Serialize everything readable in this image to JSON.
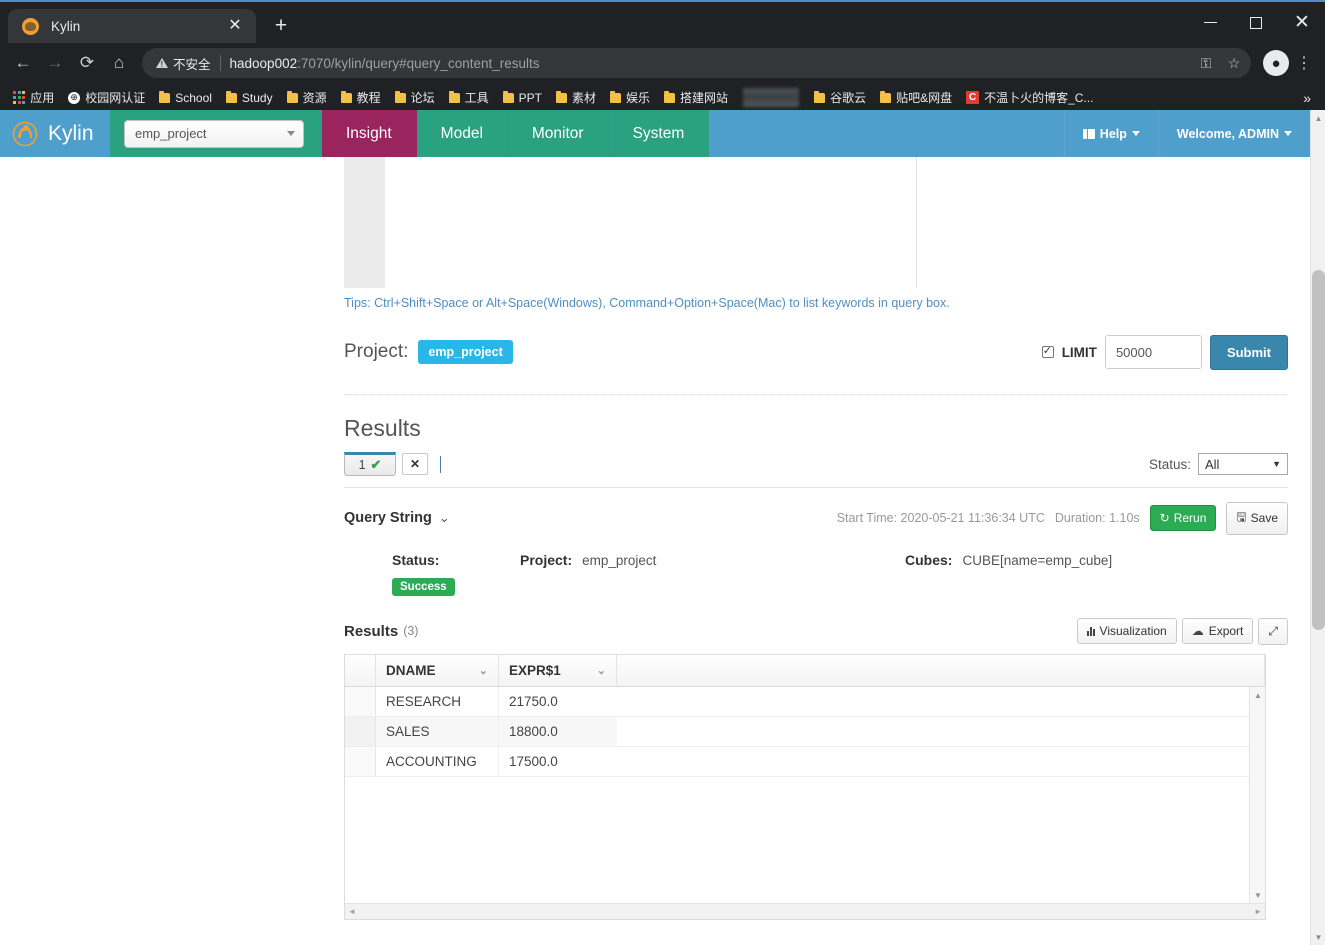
{
  "browser": {
    "tab": {
      "title": "Kylin",
      "favicon": "kylin-favicon",
      "close_label": "✕"
    },
    "new_tab_label": "+",
    "window": {
      "minimize": "—",
      "maximize": "□",
      "close": "✕"
    },
    "nav": {
      "back": "←",
      "forward": "→",
      "reload": "⟳",
      "home": "⌂"
    },
    "omnibox": {
      "security_text": "不安全",
      "url_host": "hadoop002",
      "url_rest": ":7070/kylin/query#query_content_results",
      "key_icon": "key-icon",
      "star_icon": "star-icon",
      "profile_icon": "profile-icon",
      "menu_icon": "kebab-menu-icon"
    },
    "bookmarks": [
      {
        "label": "应用",
        "icon": "apps-grid-icon"
      },
      {
        "label": "校园网认证",
        "icon": "globe-icon"
      },
      {
        "label": "School",
        "icon": "folder-icon"
      },
      {
        "label": "Study",
        "icon": "folder-icon"
      },
      {
        "label": "资源",
        "icon": "folder-icon"
      },
      {
        "label": "教程",
        "icon": "folder-icon"
      },
      {
        "label": "论坛",
        "icon": "folder-icon"
      },
      {
        "label": "工具",
        "icon": "folder-icon"
      },
      {
        "label": "PPT",
        "icon": "folder-icon"
      },
      {
        "label": "素材",
        "icon": "folder-icon"
      },
      {
        "label": "娱乐",
        "icon": "folder-icon"
      },
      {
        "label": "搭建网站",
        "icon": "folder-icon"
      },
      {
        "label": "",
        "icon": "redacted"
      },
      {
        "label": "谷歌云",
        "icon": "folder-icon"
      },
      {
        "label": "贴吧&网盘",
        "icon": "folder-icon"
      },
      {
        "label": "不温卜火的博客_C...",
        "icon": "csdn-icon"
      }
    ],
    "bookmark_overflow": "»"
  },
  "kylin": {
    "brand": "Kylin",
    "project_selector": {
      "value": "emp_project"
    },
    "menu": [
      {
        "label": "Insight",
        "active": true
      },
      {
        "label": "Model",
        "active": false
      },
      {
        "label": "Monitor",
        "active": false
      },
      {
        "label": "System",
        "active": false
      }
    ],
    "help": "Help",
    "welcome": "Welcome, ADMIN",
    "colors": {
      "navbar": "#4e9fcb",
      "menu_green": "#2aa181",
      "active_magenta": "#99245e",
      "badge_blue": "#29b6e8",
      "success_green": "#2cab55",
      "submit_blue": "#3a87ad"
    }
  },
  "editor": {
    "tips": "Tips: Ctrl+Shift+Space or Alt+Space(Windows), Command+Option+Space(Mac) to list keywords in query box."
  },
  "query_controls": {
    "project_label": "Project:",
    "project_value": "emp_project",
    "limit_label": "LIMIT",
    "limit_checked": true,
    "limit_value": "50000",
    "submit_label": "Submit"
  },
  "results_section": {
    "heading": "Results",
    "tabs": [
      {
        "label": "1",
        "status_icon": "check-icon"
      }
    ],
    "close_tab_label": "✕",
    "status_filter": {
      "label": "Status:",
      "value": "All",
      "caret": "▼"
    }
  },
  "query_detail": {
    "query_string_label": "Query String",
    "collapse_icon": "chevron-double-down-icon",
    "start_time": "Start Time: 2020-05-21 11:36:34 UTC",
    "duration": "Duration: 1.10s",
    "rerun_label": "Rerun",
    "rerun_icon": "refresh-icon",
    "save_label": "Save",
    "save_icon": "floppy-icon",
    "info": {
      "status_key": "Status:",
      "status_value": "Success",
      "project_key": "Project:",
      "project_value": "emp_project",
      "cubes_key": "Cubes:",
      "cubes_value": "CUBE[name=emp_cube]"
    }
  },
  "results_table": {
    "title": "Results",
    "count": "(3)",
    "actions": {
      "visualization": "Visualization",
      "visualization_icon": "bar-chart-icon",
      "export": "Export",
      "export_icon": "cloud-download-icon",
      "expand_icon": "expand-arrows-icon"
    },
    "columns": [
      "DNAME",
      "EXPR$1"
    ],
    "sort_icon": "chevron-down-icon",
    "rows": [
      {
        "DNAME": "RESEARCH",
        "EXPR$1": "21750.0"
      },
      {
        "DNAME": "SALES",
        "EXPR$1": "18800.0"
      },
      {
        "DNAME": "ACCOUNTING",
        "EXPR$1": "17500.0"
      }
    ]
  },
  "scrollbars": {
    "up_arrow": "▲",
    "down_arrow": "▼",
    "left_arrow": "◄",
    "right_arrow": "►"
  }
}
